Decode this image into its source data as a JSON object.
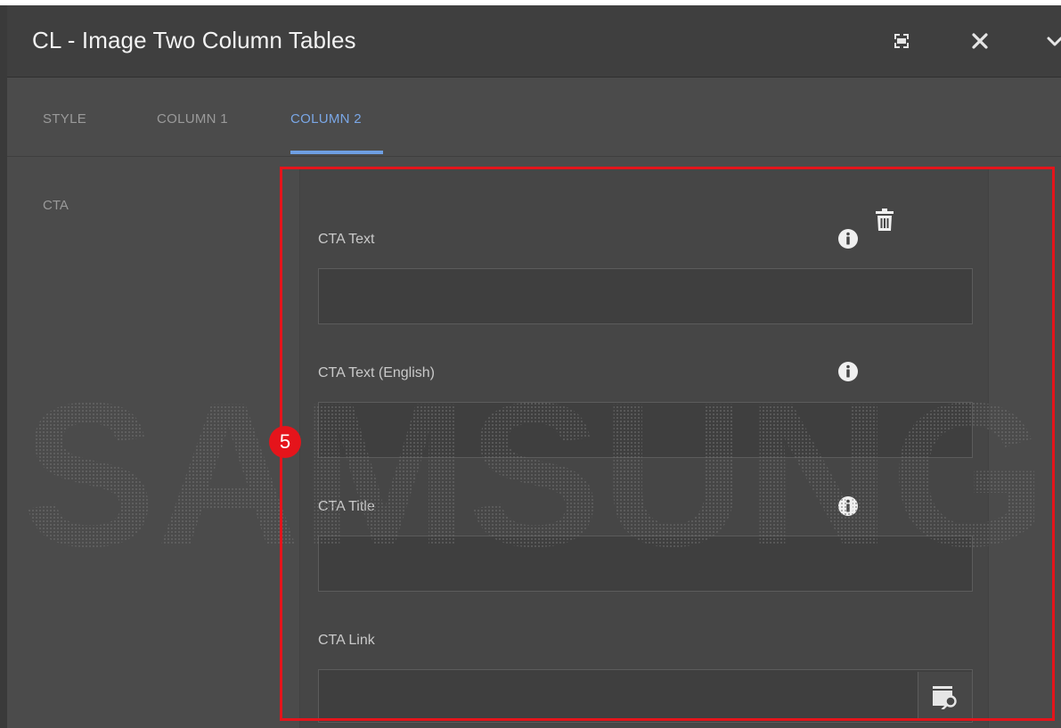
{
  "dialog": {
    "title": "CL - Image Two Column Tables",
    "header_icons": [
      "fullscreen-icon",
      "close-icon",
      "chevron-down-icon"
    ]
  },
  "tabs": [
    {
      "label": "STYLE",
      "active": false
    },
    {
      "label": "COLUMN 1",
      "active": false
    },
    {
      "label": "COLUMN 2",
      "active": true
    }
  ],
  "section": {
    "label": "CTA"
  },
  "fields": [
    {
      "label": "CTA Text",
      "value": "",
      "has_info": true,
      "has_delete": true
    },
    {
      "label": "CTA Text (English)",
      "value": "",
      "has_info": true
    },
    {
      "label": "CTA Title",
      "value": "",
      "has_info": true
    },
    {
      "label": "CTA Link",
      "value": "",
      "has_browse": true
    }
  ],
  "annotation": {
    "step": "5",
    "color": "#e5141b"
  },
  "watermark": {
    "text": "SAMSUNG"
  },
  "colors": {
    "accent": "#6e9fe3",
    "panel": "#4b4b4b",
    "header": "#3f3f3f"
  }
}
